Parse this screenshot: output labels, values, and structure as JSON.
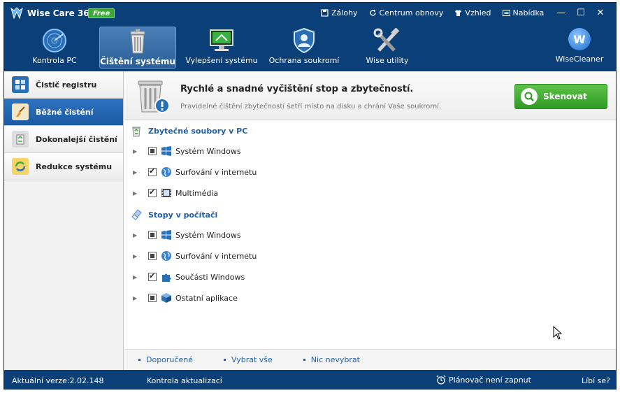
{
  "app": {
    "title": "Wise Care 365",
    "badge": "Free"
  },
  "top_links": [
    {
      "label": "Zálohy",
      "icon": "save-icon"
    },
    {
      "label": "Centrum obnovy",
      "icon": "refresh-icon"
    },
    {
      "label": "Vzhled",
      "icon": "shirt-icon"
    },
    {
      "label": "Nabídka",
      "icon": "menu-icon"
    }
  ],
  "window_buttons": {
    "minimize": "—",
    "maximize": "☐",
    "close": "✕"
  },
  "nav": {
    "tabs": [
      {
        "label": "Kontrola PC",
        "icon": "radar-icon"
      },
      {
        "label": "Čištění systému",
        "icon": "trash-bin-icon"
      },
      {
        "label": "Vylepšení systému",
        "icon": "monitor-tune-icon"
      },
      {
        "label": "Ochrana soukromí",
        "icon": "shield-user-icon"
      },
      {
        "label": "Wise utility",
        "icon": "tools-icon"
      }
    ],
    "active_tab": "Čištění systému",
    "brand": {
      "letter": "W",
      "name": "WiseCleaner"
    }
  },
  "sidebar": {
    "items": [
      {
        "label": "Čistič registru",
        "icon": "registry-icon"
      },
      {
        "label": "Běžné čistění",
        "icon": "broom-icon"
      },
      {
        "label": "Dokonalejší čistění",
        "icon": "recycle-icon"
      },
      {
        "label": "Redukce systému",
        "icon": "reduce-icon"
      }
    ],
    "active": "Běžné čistění"
  },
  "banner": {
    "title": "Rychlé a snadné vyčištění stop a zbytečností.",
    "subtitle": "Pravidelné čištění zbytečností šetří místo na disku a chrání Vaše soukromí.",
    "scan_label": "Skenovat"
  },
  "sections": [
    {
      "title": "Zbytečné soubory v PC",
      "icon": "recycle-bin-icon",
      "items": [
        {
          "label": "Systém Windows",
          "state": "partial",
          "icon": "windows-icon"
        },
        {
          "label": "Surfování v internetu",
          "state": "checked",
          "icon": "globe-icon"
        },
        {
          "label": "Multimédia",
          "state": "checked",
          "icon": "film-icon"
        }
      ]
    },
    {
      "title": "Stopy v počítači",
      "icon": "eraser-icon",
      "items": [
        {
          "label": "Systém Windows",
          "state": "partial",
          "icon": "windows-icon"
        },
        {
          "label": "Surfování v internetu",
          "state": "partial",
          "icon": "globe-icon"
        },
        {
          "label": "Součásti Windows",
          "state": "checked",
          "icon": "puzzle-icon"
        },
        {
          "label": "Ostatní aplikace",
          "state": "partial",
          "icon": "box-icon"
        }
      ]
    }
  ],
  "footer_links": [
    "Doporučené",
    "Vybrat vše",
    "Nic nevybrat"
  ],
  "status": {
    "version": "Aktuální verze:2.02.148",
    "check_updates": "Kontrola aktualizací",
    "scheduler": "Plánovač není zapnut",
    "like": "Líbí se?"
  },
  "colors": {
    "frame": "#0b3f78",
    "accent_blue": "#1f5fa8",
    "scan_green": "#3aa935",
    "sidebar_active": "#2f73c0"
  }
}
